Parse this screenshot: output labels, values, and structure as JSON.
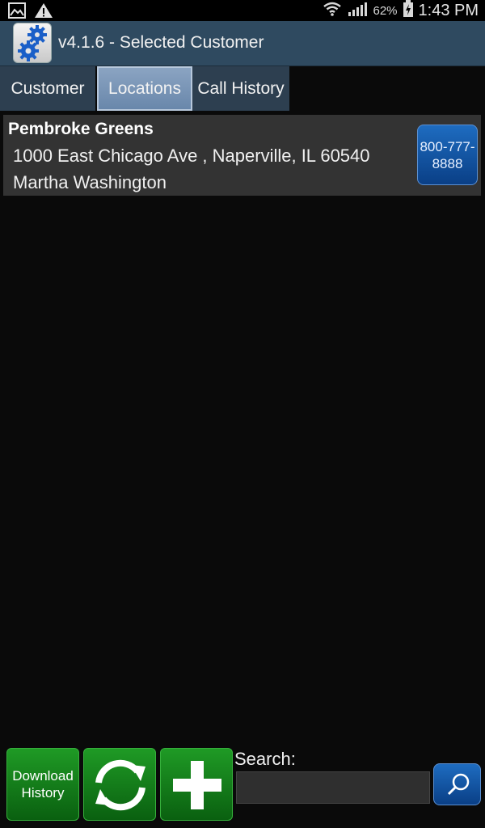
{
  "status_bar": {
    "battery_percent": "62%",
    "time": "1:43 PM",
    "icons": [
      "image-notification-icon",
      "warning-icon",
      "wifi-icon",
      "signal-icon",
      "battery-charging-icon"
    ]
  },
  "title_bar": {
    "title": "v4.1.6 - Selected Customer",
    "icon": "gears-icon"
  },
  "tabs": [
    {
      "label": "Customer",
      "active": false
    },
    {
      "label": "Locations",
      "active": true
    },
    {
      "label": "Call History",
      "active": false
    }
  ],
  "locations": [
    {
      "name": "Pembroke Greens",
      "address": "1000 East Chicago Ave , Naperville, IL 60540",
      "contact": "Martha Washington",
      "phone": "800-777-8888"
    }
  ],
  "toolbar": {
    "download_label": "Download History",
    "refresh_icon": "refresh-icon",
    "add_icon": "plus-icon",
    "search_label": "Search:",
    "search_value": "",
    "search_icon": "search-icon"
  },
  "colors": {
    "title_bar": "#2f4a60",
    "active_tab": "#7592b6",
    "phone_button": "#0f4f9e",
    "action_button_green": "#15801b"
  }
}
